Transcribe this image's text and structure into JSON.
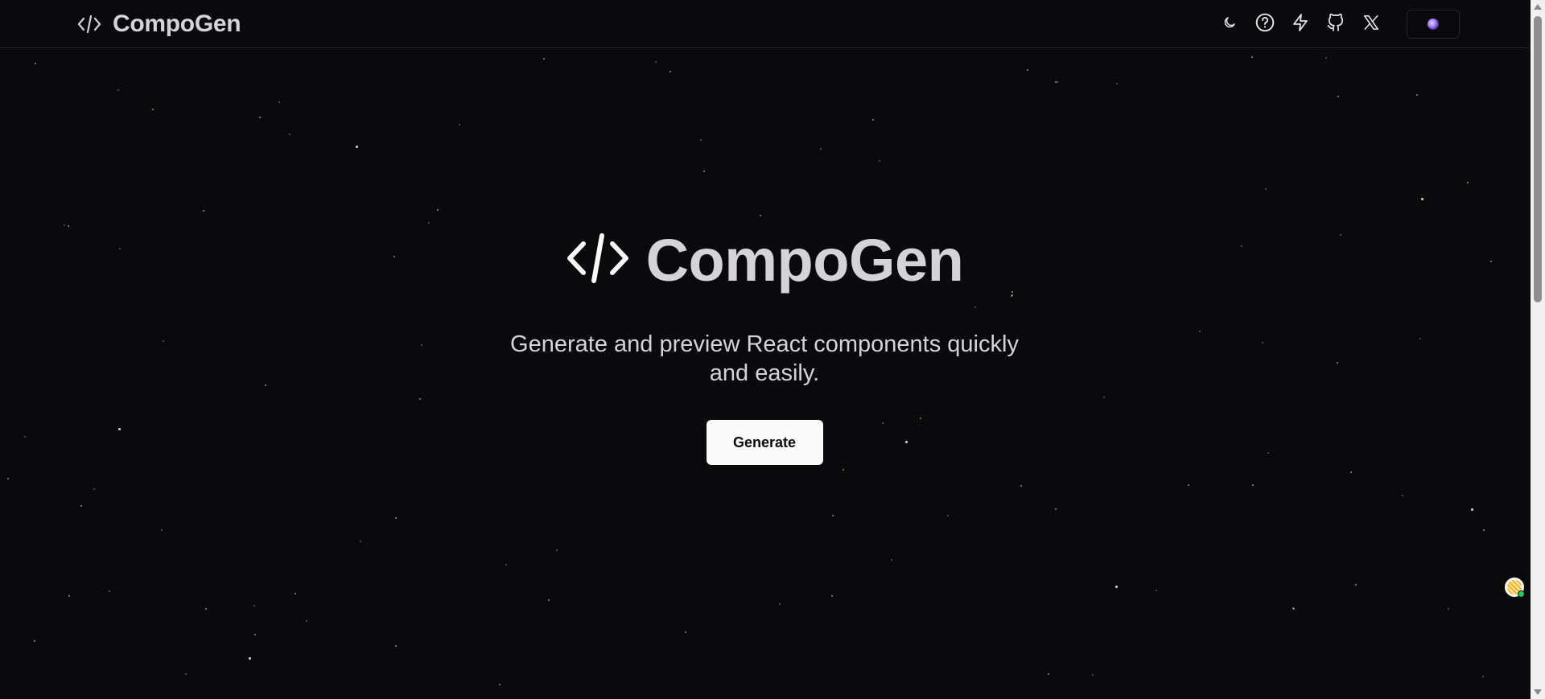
{
  "header": {
    "brand_title": "CompoGen",
    "nav": [
      {
        "name": "theme-toggle-button",
        "icon": "moon-icon"
      },
      {
        "name": "help-button",
        "icon": "help-circle-icon"
      },
      {
        "name": "generate-shortcut-button",
        "icon": "zap-icon"
      },
      {
        "name": "github-link",
        "icon": "github-icon"
      },
      {
        "name": "x-link",
        "icon": "x-icon"
      }
    ]
  },
  "hero": {
    "title": "CompoGen",
    "subtitle": "Generate and preview React components quickly and easily.",
    "cta_label": "Generate"
  },
  "colors": {
    "background": "#0a0a0c",
    "text": "#d4d4d8",
    "button_bg": "#fafafa",
    "button_text": "#09090b",
    "border": "#27272a"
  }
}
